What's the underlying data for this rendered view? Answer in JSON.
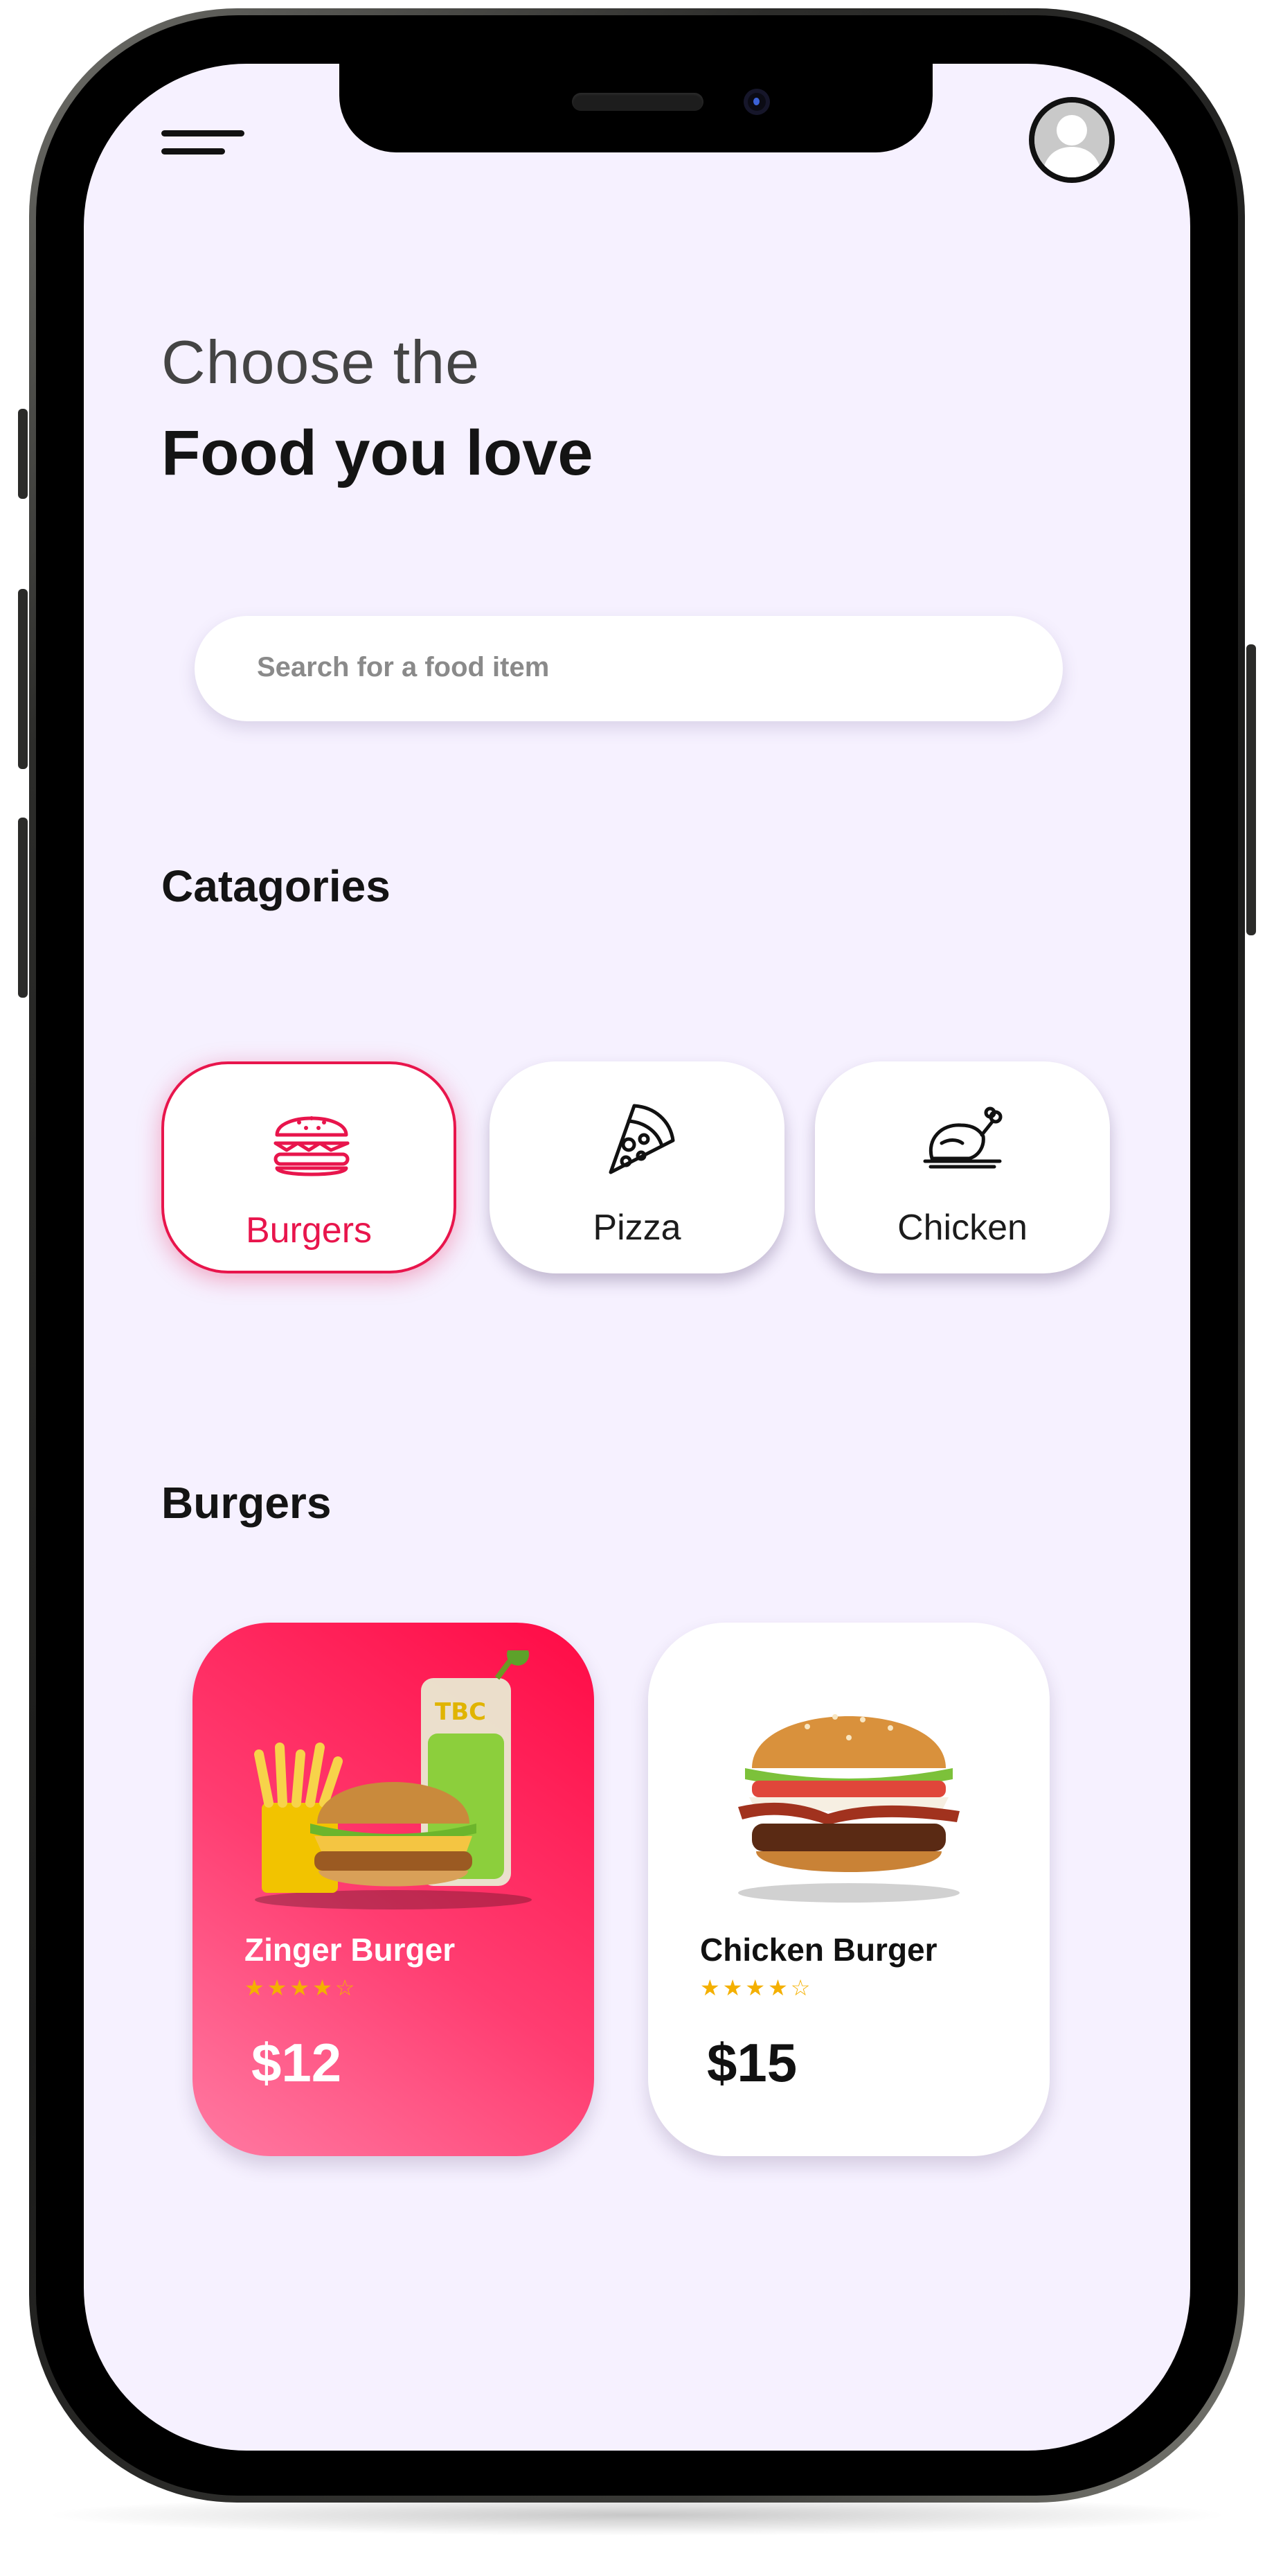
{
  "header": {
    "heading_line1": "Choose the",
    "heading_line2": "Food you love"
  },
  "search": {
    "placeholder": "Search for a food item"
  },
  "categories": {
    "title": "Catagories",
    "items": [
      {
        "label": "Burgers",
        "icon": "burger-icon",
        "selected": true
      },
      {
        "label": "Pizza",
        "icon": "pizza-icon",
        "selected": false
      },
      {
        "label": "Chicken",
        "icon": "roast-chicken-icon",
        "selected": false
      }
    ]
  },
  "section": {
    "title": "Burgers"
  },
  "products": [
    {
      "name": "Zinger Burger",
      "price": "$12",
      "rating": 4,
      "rating_max": 5,
      "highlighted": true
    },
    {
      "name": "Chicken Burger",
      "price": "$15",
      "rating": 4,
      "rating_max": 5,
      "highlighted": false
    }
  ],
  "colors": {
    "accent": "#e8154c",
    "background": "#f6f1ff",
    "star": "#f4b000"
  }
}
